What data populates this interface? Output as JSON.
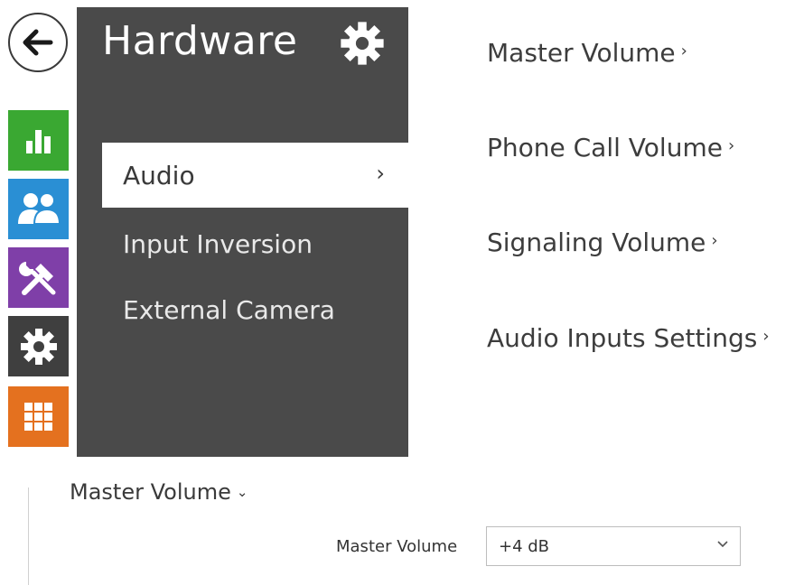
{
  "sidebar": {
    "tiles": [
      {
        "name": "status",
        "icon": "bar-chart-icon",
        "color": "#3aa832"
      },
      {
        "name": "directory",
        "icon": "users-icon",
        "color": "#2a8fd4"
      },
      {
        "name": "hardware",
        "icon": "tools-icon",
        "color": "#7f3fa8"
      },
      {
        "name": "system",
        "icon": "gear-icon",
        "color": "#3f3f3f"
      },
      {
        "name": "services",
        "icon": "grid-icon",
        "color": "#e4711f"
      }
    ]
  },
  "panel": {
    "title": "Hardware",
    "bg_color": "#4a4a4a",
    "items": [
      {
        "label": "Audio",
        "chevron": "›",
        "active": true
      },
      {
        "label": "Input Inversion",
        "active": false
      },
      {
        "label": "External Camera",
        "active": false
      }
    ]
  },
  "content": {
    "links": [
      {
        "label": "Master Volume",
        "arrow": "›"
      },
      {
        "label": "Phone Call Volume",
        "arrow": "›"
      },
      {
        "label": "Signaling Volume",
        "arrow": "›"
      },
      {
        "label": "Audio Inputs Settings",
        "arrow": "›"
      }
    ]
  },
  "section": {
    "title": "Master Volume",
    "arrow": "⌄",
    "field_label": "Master Volume",
    "select_value": "+4 dB"
  }
}
